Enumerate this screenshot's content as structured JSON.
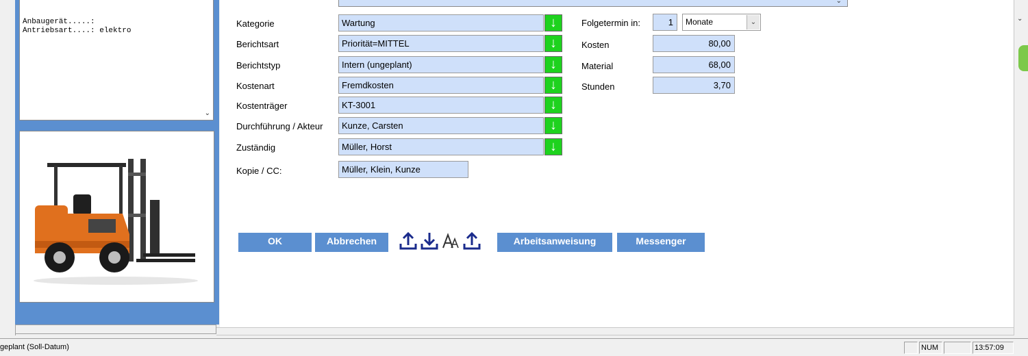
{
  "info": {
    "lines": "Anbaugerät.....:\nAntriebsart....: elektro"
  },
  "form": {
    "labels": {
      "kategorie": "Kategorie",
      "berichtsart": "Berichtsart",
      "berichtstyp": "Berichtstyp",
      "kostenart": "Kostenart",
      "kostentraeger": "Kostenträger",
      "durchfuehrung": "Durchführung / Akteur",
      "zustaendig": "Zuständig",
      "kopie": "Kopie / CC:"
    },
    "values": {
      "kategorie": "Wartung",
      "berichtsart": "Priorität=MITTEL",
      "berichtstyp": "Intern (ungeplant)",
      "kostenart": "Fremdkosten",
      "kostentraeger": "KT-3001",
      "durchfuehrung": "Kunze, Carsten",
      "zustaendig": "Müller, Horst",
      "kopie": "Müller, Klein, Kunze"
    },
    "picker_glyph": "↓"
  },
  "right_form": {
    "folgetermin_label": "Folgetermin in:",
    "folgetermin_value": "1",
    "folgetermin_unit": "Monate",
    "kosten_label": "Kosten",
    "kosten_value": "80,00",
    "material_label": "Material",
    "material_value": "68,00",
    "stunden_label": "Stunden",
    "stunden_value": "3,70"
  },
  "buttons": {
    "ok": "OK",
    "abbrechen": "Abbrechen",
    "arbeitsanweisung": "Arbeitsanweisung",
    "messenger": "Messenger"
  },
  "toolbar_icons": [
    "upload-icon",
    "download-icon",
    "font-size-icon",
    "upload-icon"
  ],
  "statusbar": {
    "message": "geplant (Soll-Datum)",
    "num": "NUM",
    "time": "13:57:09"
  },
  "colors": {
    "panel_blue": "#5b8fd0",
    "field_blue": "#cfe0fa",
    "picker_green": "#1ed21e",
    "icon_navy": "#1a2b8c"
  }
}
